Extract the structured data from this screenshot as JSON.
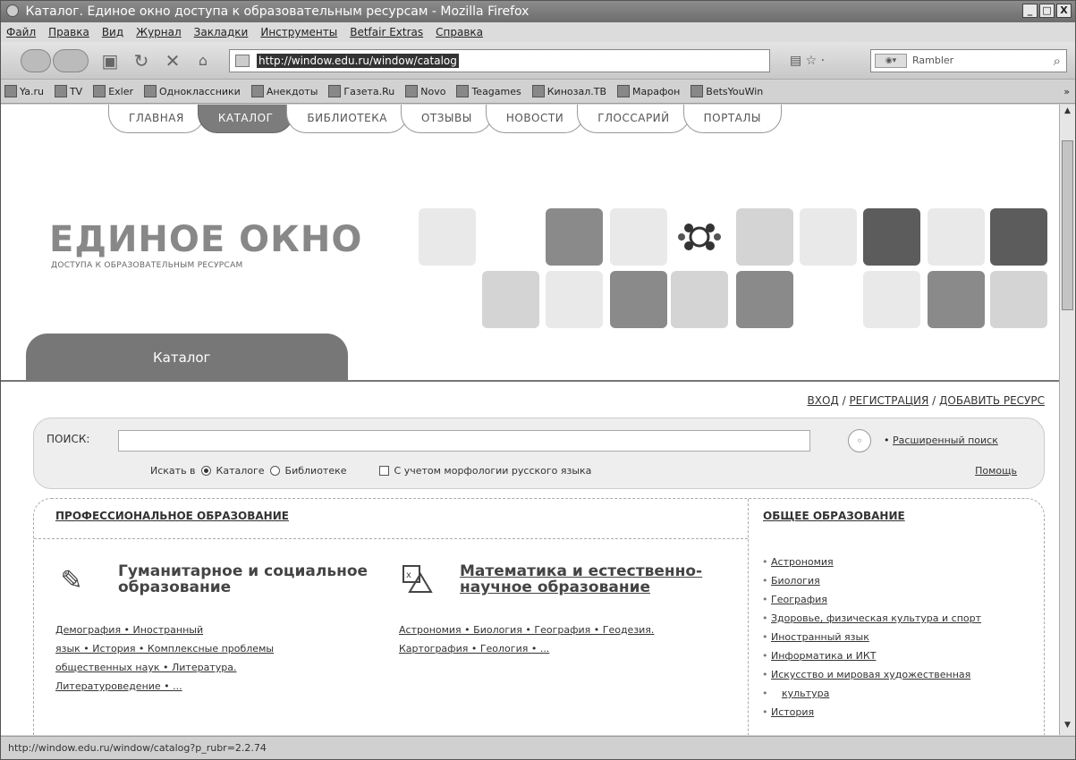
{
  "window": {
    "title": "Каталог. Единое окно доступа к образовательным ресурсам - Mozilla Firefox",
    "minimize": "_",
    "restore": "□",
    "close": "X"
  },
  "menu": [
    "Файл",
    "Правка",
    "Вид",
    "Журнал",
    "Закладки",
    "Инструменты",
    "Betfair Extras",
    "Справка"
  ],
  "nav": {
    "url": "http://window.edu.ru/window/catalog",
    "search_engine": "Rambler"
  },
  "bookmarks": [
    "Ya.ru",
    "TV",
    "Exler",
    "Одноклассники",
    "Анекдоты",
    "Газета.Ru",
    "Novo",
    "Teagames",
    "Кинозал.ТВ",
    "Марафон",
    "BetsYouWin"
  ],
  "bookmarks_more": "»",
  "site_tabs": [
    "ГЛАВНАЯ",
    "КАТАЛОГ",
    "БИБЛИОТЕКА",
    "ОТЗЫВЫ",
    "НОВОСТИ",
    "ГЛОССАРИЙ",
    "ПОРТАЛЫ"
  ],
  "logo": {
    "title": "ЕДИНОЕ ОКНО",
    "subtitle": "ДОСТУПА К ОБРАЗОВАТЕЛЬНЫМ РЕСУРСАМ"
  },
  "catalog_tab": "Каталог",
  "auth": {
    "login": "ВХОД",
    "register": "РЕГИСТРАЦИЯ",
    "add": "ДОБАВИТЬ РЕСУРС",
    "sep": " / "
  },
  "search": {
    "label": "ПОИСК:",
    "advanced": "Расширенный поиск",
    "search_in": "Искать в",
    "opt_catalog": "Каталоге",
    "opt_library": "Библиотеке",
    "morphology": "С учетом морфологии русского языка",
    "help": "Помощь"
  },
  "rubrics": {
    "professional_title": "ПРОФЕССИОНАЛЬНОЕ ОБРАЗОВАНИЕ",
    "general_title": "ОБЩЕЕ ОБРАЗОВАНИЕ",
    "humanities": {
      "title_line1": "Гуманитарное и социальное",
      "title_line2": "образование",
      "links_line1": "Демография • Иностранный",
      "links_line2": "язык • История • Комплексные проблемы",
      "links_line3": "общественных наук • Литература.",
      "links_line4": "Литературоведение • ..."
    },
    "science": {
      "title_line1": "Математика и естественно-",
      "title_line2": "научное образование",
      "links_line1": "Астрономия • Биология • География • Геодезия.",
      "links_line2": "Картография • Геология • ..."
    },
    "general_items": [
      "Астрономия",
      "Биология",
      "География",
      "Здоровье, физическая культура и спорт",
      "Иностранный язык",
      "Информатика и ИКТ",
      "Искусство и мировая художественная",
      "культура",
      "История"
    ]
  },
  "status": "http://window.edu.ru/window/catalog?p_rubr=2.2.74"
}
